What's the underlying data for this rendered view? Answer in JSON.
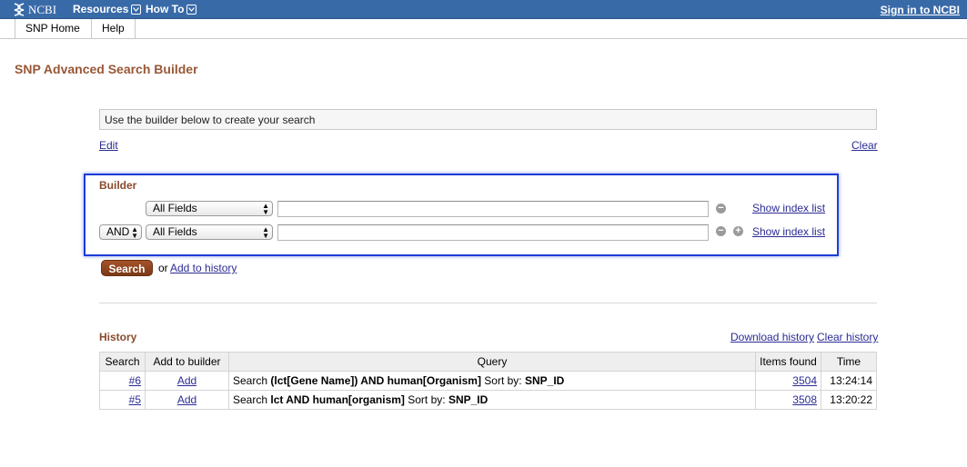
{
  "topbar": {
    "logo_text": "NCBI",
    "menu": [
      {
        "label": "Resources",
        "icon": "chevron-down-icon"
      },
      {
        "label": "How To",
        "icon": "chevron-down-icon"
      }
    ],
    "signin_label": "Sign in to NCBI"
  },
  "subnav": {
    "tabs": [
      {
        "label": "SNP Home"
      },
      {
        "label": "Help"
      }
    ]
  },
  "page": {
    "title": "SNP Advanced Search Builder"
  },
  "query_box": {
    "placeholder": "Use the builder below to create your search"
  },
  "links": {
    "edit": "Edit",
    "clear": "Clear"
  },
  "builder": {
    "label": "Builder",
    "rows": [
      {
        "operator": "",
        "field": "All Fields",
        "term": "",
        "show_index": "Show index list",
        "buttons": [
          "remove"
        ]
      },
      {
        "operator": "AND",
        "field": "All Fields",
        "term": "",
        "show_index": "Show index list",
        "buttons": [
          "remove",
          "add"
        ]
      }
    ]
  },
  "actions": {
    "search_label": "Search",
    "or_text": "or",
    "add_to_history": "Add to history"
  },
  "history": {
    "label": "History",
    "download": "Download history",
    "clear": "Clear history",
    "columns": [
      "Search",
      "Add to builder",
      "Query",
      "Items found",
      "Time"
    ],
    "rows": [
      {
        "search": "#6",
        "add": "Add",
        "query_prefix": "Search ",
        "query_bold": "(lct[Gene Name]) AND human[Organism]",
        "query_sort": " Sort by: ",
        "query_sort_value": "SNP_ID",
        "items": "3504",
        "time": "13:24:14"
      },
      {
        "search": "#5",
        "add": "Add",
        "query_prefix": "Search ",
        "query_bold": "lct AND human[organism]",
        "query_sort": " Sort by: ",
        "query_sort_value": "SNP_ID",
        "items": "3508",
        "time": "13:20:22"
      }
    ]
  },
  "colors": {
    "topbar": "#396aa8",
    "title": "#985735",
    "section_label": "#8a4b2d",
    "link": "#2b2b95",
    "builder_highlight": "#1c3cd8",
    "search_button": "#8b4420"
  }
}
